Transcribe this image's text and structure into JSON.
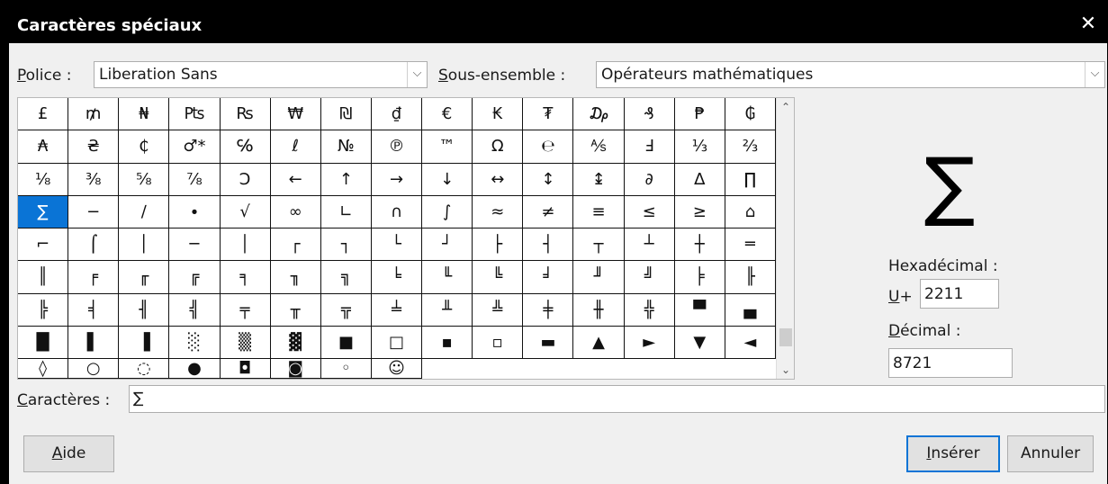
{
  "window": {
    "title": "Caractères spéciaux",
    "close_glyph": "✕"
  },
  "font": {
    "label_u": "P",
    "label_rest": "olice :",
    "value": "Liberation Sans",
    "arrow": "⌵"
  },
  "subset": {
    "label_u": "S",
    "label_rest": "ous-ensemble :",
    "value": "Opérateurs mathématiques",
    "arrow": "⌵"
  },
  "grid": {
    "selected": "∑",
    "cells": [
      "£",
      "₥",
      "₦",
      "₧",
      "₨",
      "₩",
      "₪",
      "₫",
      "€",
      "₭",
      "₮",
      "₯",
      "₰",
      "₱",
      "₲",
      "₳",
      "₴",
      "₵",
      "♂*",
      "℅",
      "ℓ",
      "№",
      "℗",
      "™",
      "Ω",
      "℮",
      "⅍",
      "Ⅎ",
      "⅓",
      "⅔",
      "⅛",
      "⅜",
      "⅝",
      "⅞",
      "Ↄ",
      "←",
      "↑",
      "→",
      "↓",
      "↔",
      "↕",
      "↨",
      "∂",
      "∆",
      "∏",
      "∑",
      "−",
      "∕",
      "∙",
      "√",
      "∞",
      "∟",
      "∩",
      "∫",
      "≈",
      "≠",
      "≡",
      "≤",
      "≥",
      "⌂",
      "⌐",
      "⌠",
      "│",
      "─",
      "│",
      "┌",
      "┐",
      "└",
      "┘",
      "├",
      "┤",
      "┬",
      "┴",
      "┼",
      "═",
      "║",
      "╒",
      "╓",
      "╔",
      "╕",
      "╖",
      "╗",
      "╘",
      "╙",
      "╚",
      "╛",
      "╜",
      "╝",
      "╞",
      "╟",
      "╠",
      "╡",
      "╢",
      "╣",
      "╤",
      "╥",
      "╦",
      "╧",
      "╨",
      "╩",
      "╪",
      "╫",
      "╬",
      "▀",
      "▄",
      "█",
      "▌",
      "▐",
      "░",
      "▒",
      "▓",
      "■",
      "□",
      "▪",
      "▫",
      "▬",
      "▲",
      "►",
      "▼",
      "◄",
      "◊",
      "○",
      "◌",
      "●",
      "◘",
      "◙",
      "◦",
      "☺"
    ],
    "scroll_up": "⌃",
    "scroll_down": "⌄"
  },
  "preview": {
    "glyph": "∑"
  },
  "hex": {
    "label": "Hexadécimal :",
    "prefix_u": "U",
    "prefix_rest": "+",
    "value": "2211"
  },
  "decimal": {
    "label_u": "D",
    "label_rest": "écimal :",
    "value": "8721"
  },
  "characters": {
    "label_u": "C",
    "label_rest": "aractères :",
    "value": "∑"
  },
  "buttons": {
    "help_u": "A",
    "help_rest": "ide",
    "insert_u": "I",
    "insert_rest": "nsérer",
    "cancel": "Annuler"
  },
  "colors": {
    "selection": "#0a74d6",
    "titlebar": "#000000",
    "dialog_bg": "#f0f0f0"
  }
}
